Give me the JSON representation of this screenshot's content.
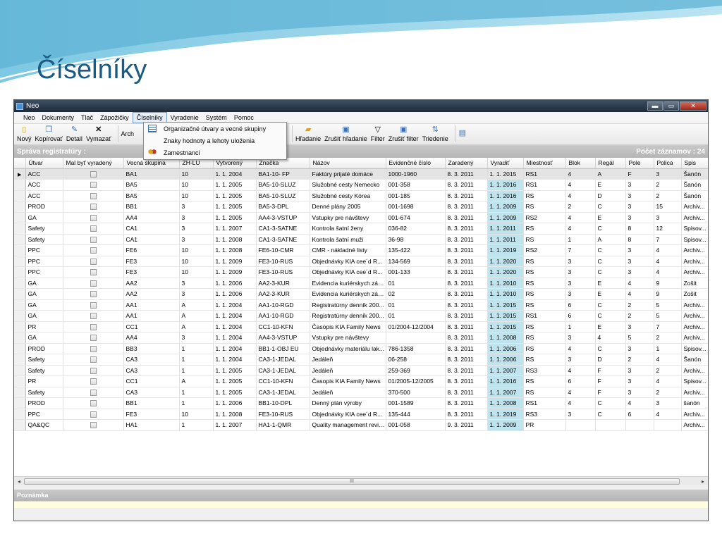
{
  "slide": {
    "title": "Číselníky"
  },
  "window": {
    "title": "Neo",
    "controls": {
      "minimize": "▬",
      "maximize": "▭",
      "close": "✕"
    }
  },
  "menu": [
    "Neo",
    "Dokumenty",
    "Tlač",
    "Zápožičky",
    "Číselníky",
    "Vyradenie",
    "Systém",
    "Pomoc"
  ],
  "toolbar": {
    "novy": "Nový",
    "kopirovat": "Kopírovať",
    "detail": "Detail",
    "vymazat": "Vymazať",
    "arch": "Arch",
    "hladanie": "Hľadanie",
    "zrusit_hladanie": "Zrušiť hľadanie",
    "filter": "Filter",
    "zrusit_filter": "Zrušiť filter",
    "triedenie": "Triedenie"
  },
  "dropdown": [
    {
      "label": "Organizačné útvary a vecné skupiny",
      "icon": "list-icon"
    },
    {
      "label": "Znaky hodnoty a lehoty uloženia",
      "icon": "none"
    },
    {
      "label": "Zamestnanci",
      "icon": "users-icon"
    }
  ],
  "panel": {
    "title": "Správa registratúry  :",
    "count": "Počet záznamov : 24"
  },
  "columns": [
    "Útvar",
    "Mal byť vyradený",
    "Vecná skupina",
    "ZH-LU",
    "Vytvorený",
    "Značka",
    "Názov",
    "Evidenčné číslo",
    "Zaradený",
    "Vyradiť",
    "Miestnosť",
    "Blok",
    "Regál",
    "Pole",
    "Polica",
    "Spis"
  ],
  "rows": [
    [
      "ACC",
      "",
      "BA1",
      "10",
      "1. 1. 2004",
      "BA1-10- FP",
      "Faktúry prijaté domáce",
      "1000-1960",
      "8. 3. 2011",
      "1. 1. 2015",
      "RS1",
      "4",
      "A",
      "F",
      "3",
      "Šanón"
    ],
    [
      "ACC",
      "",
      "BA5",
      "10",
      "1. 1. 2005",
      "BA5-10-SLUZ",
      "Služobné cesty Nemecko",
      "001-358",
      "8. 3. 2011",
      "1. 1. 2016",
      "RS1",
      "4",
      "E",
      "3",
      "2",
      "Šanón"
    ],
    [
      "ACC",
      "",
      "BA5",
      "10",
      "1. 1. 2005",
      "BA5-10-SLUZ",
      "Služobné cesty Kórea",
      "001-185",
      "8. 3. 2011",
      "1. 1. 2016",
      "RS",
      "4",
      "D",
      "3",
      "2",
      "Šanón"
    ],
    [
      "PROD",
      "",
      "BB1",
      "3",
      "1. 1. 2005",
      "BA5-3-DPL",
      "Denné plány 2005",
      "001-1698",
      "8. 3. 2011",
      "1. 1. 2009",
      "RS",
      "2",
      "C",
      "3",
      "15",
      "Archiv..."
    ],
    [
      "GA",
      "",
      "AA4",
      "3",
      "1. 1. 2005",
      "AA4-3-VSTUP",
      "Vstupky pre návštevy",
      "001-674",
      "8. 3. 2011",
      "1. 1. 2009",
      "RS2",
      "4",
      "E",
      "3",
      "3",
      "Archiv..."
    ],
    [
      "Safety",
      "",
      "CA1",
      "3",
      "1. 1. 2007",
      "CA1-3-SATNE",
      "Kontrola šatní ženy",
      "036-82",
      "8. 3. 2011",
      "1. 1. 2011",
      "RS",
      "4",
      "C",
      "8",
      "12",
      "Spisov..."
    ],
    [
      "Safety",
      "",
      "CA1",
      "3",
      "1. 1. 2008",
      "CA1-3-SATNE",
      "Kontrola šatní muži",
      "36-98",
      "8. 3. 2011",
      "1. 1. 2011",
      "RS",
      "1",
      "A",
      "8",
      "7",
      "Spisov..."
    ],
    [
      "PPC",
      "",
      "FE6",
      "10",
      "1. 1. 2008",
      "FE6-10-CMR",
      "CMR - nákladné listy",
      "135-422",
      "8. 3. 2011",
      "1. 1. 2019",
      "RS2",
      "7",
      "C",
      "3",
      "4",
      "Archiv..."
    ],
    [
      "PPC",
      "",
      "FE3",
      "10",
      "1. 1. 2009",
      "FE3-10-RUS",
      "Objednávky KIA cee´d  R...",
      "134-569",
      "8. 3. 2011",
      "1. 1. 2020",
      "RS",
      "3",
      "C",
      "3",
      "4",
      "Archiv..."
    ],
    [
      "PPC",
      "",
      "FE3",
      "10",
      "1. 1. 2009",
      "FE3-10-RUS",
      "Objednávky KIA cee´d  R...",
      "001-133",
      "8. 3. 2011",
      "1. 1. 2020",
      "RS",
      "3",
      "C",
      "3",
      "4",
      "Archiv..."
    ],
    [
      "GA",
      "",
      "AA2",
      "3",
      "1. 1. 2006",
      "AA2-3-KUR",
      "Evidencia kuriérskych zás...",
      "01",
      "8. 3. 2011",
      "1. 1. 2010",
      "RS",
      "3",
      "E",
      "4",
      "9",
      "Zošit"
    ],
    [
      "GA",
      "",
      "AA2",
      "3",
      "1. 1. 2006",
      "AA2-3-KUR",
      "Evidencia kuriérskych zás...",
      "02",
      "8. 3. 2011",
      "1. 1. 2010",
      "RS",
      "3",
      "E",
      "4",
      "9",
      "Zošit"
    ],
    [
      "GA",
      "",
      "AA1",
      "A",
      "1. 1. 2004",
      "AA1-10-RGD",
      "Registratúrny denník 200...",
      "01",
      "8. 3. 2011",
      "1. 1. 2015",
      "RS",
      "6",
      "C",
      "2",
      "5",
      "Archiv..."
    ],
    [
      "GA",
      "",
      "AA1",
      "A",
      "1. 1. 2004",
      "AA1-10-RGD",
      "Registratúrny denník 200...",
      "01",
      "8. 3. 2011",
      "1. 1. 2015",
      "RS1",
      "6",
      "C",
      "2",
      "5",
      "Archiv..."
    ],
    [
      "PR",
      "",
      "CC1",
      "A",
      "1. 1. 2004",
      "CC1-10-KFN",
      "Časopis KIA Family News",
      "01/2004-12/2004",
      "8. 3. 2011",
      "1. 1. 2015",
      "RS",
      "1",
      "E",
      "3",
      "7",
      "Archiv..."
    ],
    [
      "GA",
      "",
      "AA4",
      "3",
      "1. 1. 2004",
      "AA4-3-VSTUP",
      "Vstupky pre návštevy",
      "",
      "8. 3. 2011",
      "1. 1. 2008",
      "RS",
      "3",
      "4",
      "5",
      "2",
      "Archiv..."
    ],
    [
      "PROD",
      "",
      "BB3",
      "1",
      "1. 1. 2004",
      "BB1-1-OBJ EU",
      "Objednávky materiálu lak...",
      "786-1358",
      "8. 3. 2011",
      "1. 1. 2006",
      "RS",
      "4",
      "C",
      "3",
      "1",
      "Spisov..."
    ],
    [
      "Safety",
      "",
      "CA3",
      "1",
      "1. 1. 2004",
      "CA3-1-JEDAL",
      "Jedáleň",
      "06-258",
      "8. 3. 2011",
      "1. 1. 2006",
      "RS",
      "3",
      "D",
      "2",
      "4",
      "Šanón"
    ],
    [
      "Safety",
      "",
      "CA3",
      "1",
      "1. 1. 2005",
      "CA3-1-JEDAL",
      "Jedáleň",
      "259-369",
      "8. 3. 2011",
      "1. 1. 2007",
      "RS3",
      "4",
      "F",
      "3",
      "2",
      "Archiv..."
    ],
    [
      "PR",
      "",
      "CC1",
      "A",
      "1. 1. 2005",
      "CC1-10-KFN",
      "Časopis KIA Family News",
      "01/2005-12/2005",
      "8. 3. 2011",
      "1. 1. 2016",
      "RS",
      "6",
      "F",
      "3",
      "4",
      "Spisov..."
    ],
    [
      "Safety",
      "",
      "CA3",
      "1",
      "1. 1. 2005",
      "CA3-1-JEDAL",
      "Jedáleň",
      "370-500",
      "8. 3. 2011",
      "1. 1. 2007",
      "RS",
      "4",
      "F",
      "3",
      "2",
      "Archiv..."
    ],
    [
      "PROD",
      "",
      "BB1",
      "1",
      "1. 1. 2006",
      "BB1-10-DPL",
      "Denný plán výroby",
      "001-1589",
      "8. 3. 2011",
      "1. 1. 2008",
      "RS1",
      "4",
      "C",
      "4",
      "3",
      "šanón"
    ],
    [
      "PPC",
      "",
      "FE3",
      "10",
      "1. 1. 2008",
      "FE3-10-RUS",
      "Objednávky KIA cee´d  R...",
      "135-444",
      "8. 3. 2011",
      "1. 1. 2019",
      "RS3",
      "3",
      "C",
      "6",
      "4",
      "Archiv..."
    ],
    [
      "QA&QC",
      "",
      "HA1",
      "1",
      "1. 1. 2007",
      "HA1-1-QMR",
      "Quality management review",
      "001-058",
      "9. 3. 2011",
      "1. 1. 2009",
      "PR",
      "",
      "",
      "",
      "",
      "Archiv..."
    ]
  ],
  "selected_row": 0,
  "scrollbar": {
    "left": "◂",
    "right": "▸",
    "grip": "III"
  },
  "note": {
    "title": "Poznámka"
  },
  "colors": {
    "title": "#1b5a82",
    "vyradit_bg": "#bfe4ee"
  }
}
